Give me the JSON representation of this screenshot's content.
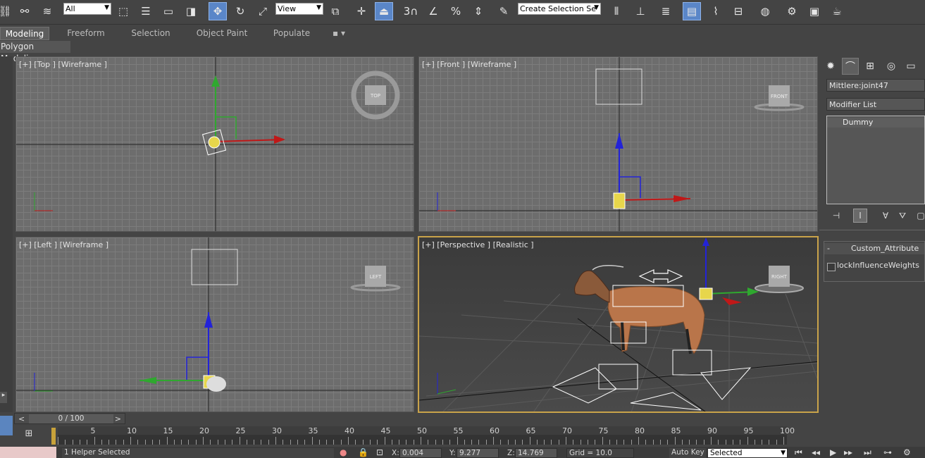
{
  "toolbar": {
    "selection_filter": "All",
    "coord_system": "View",
    "named_selection": "Create Selection Se",
    "snap_angle_label": "3",
    "colors": {
      "active": "#5a86c8",
      "bg": "#444444"
    }
  },
  "ribbon": {
    "tabs": [
      {
        "label": "Modeling",
        "active": true
      },
      {
        "label": "Freeform",
        "active": false
      },
      {
        "label": "Selection",
        "active": false
      },
      {
        "label": "Object Paint",
        "active": false
      },
      {
        "label": "Populate",
        "active": false
      }
    ],
    "subpanel": "Polygon Modeling"
  },
  "viewports": {
    "top": {
      "label": "[+] [Top ] [Wireframe ]",
      "cube": "TOP"
    },
    "front": {
      "label": "[+] [Front ] [Wireframe ]",
      "cube": "FRONT"
    },
    "left": {
      "label": "[+] [Left ] [Wireframe ]",
      "cube": "LEFT"
    },
    "perspective": {
      "label": "[+] [Perspective ] [Realistic ]",
      "cube": "RIGHT"
    },
    "axis": {
      "x": "x",
      "y": "y",
      "z": "z"
    }
  },
  "command_panel": {
    "object_name": "Mittlere:joint47",
    "modifier_list": "Modifier List",
    "stack_items": [
      "Dummy"
    ],
    "rollout_title": "Custom_Attribute",
    "rollout_sign": "-",
    "checkbox_label": "lockInfluenceWeights",
    "checkbox_checked": false
  },
  "time_slider": {
    "label": "0 / 100",
    "prev": "<",
    "next": ">"
  },
  "track_ticks": [
    "5",
    "10",
    "15",
    "20",
    "25",
    "30",
    "35",
    "40",
    "45",
    "50",
    "55",
    "60",
    "65",
    "70",
    "75",
    "80",
    "85",
    "90",
    "95",
    "100"
  ],
  "status": {
    "selection": "1 Helper Selected",
    "x_label": "X:",
    "x_value": "0.004",
    "y_label": "Y:",
    "y_value": "9.277",
    "z_label": "Z:",
    "z_value": "14.769",
    "grid": "Grid = 10.0",
    "auto_key": "Auto Key",
    "key_filter": "Selected"
  }
}
